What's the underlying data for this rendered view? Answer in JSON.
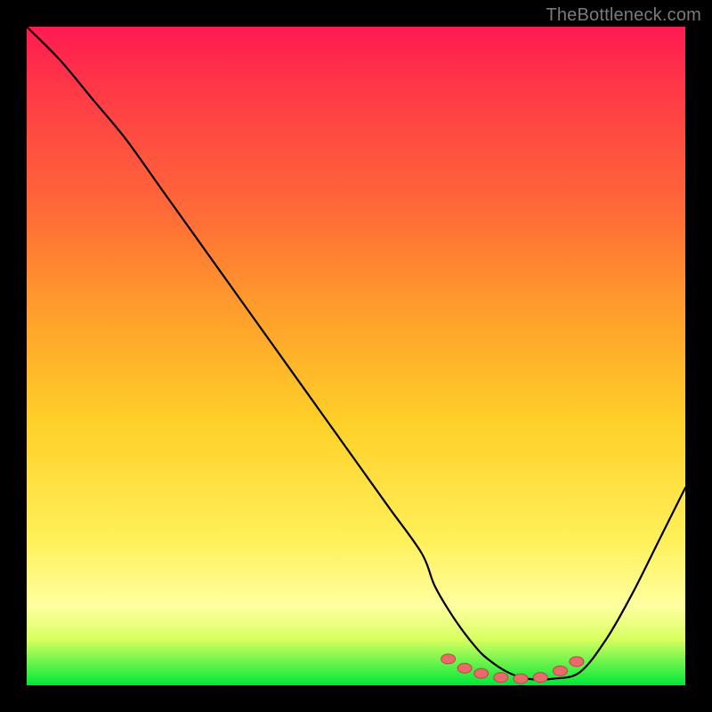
{
  "watermark": "TheBottleneck.com",
  "colors": {
    "background": "#000000",
    "curve": "#000000",
    "marker_fill": "#e96a6a",
    "marker_stroke": "#b94848",
    "gradient_top": "#ff1a52",
    "gradient_bottom": "#00e838"
  },
  "chart_data": {
    "type": "line",
    "title": "",
    "xlabel": "",
    "ylabel": "",
    "xlim": [
      0,
      100
    ],
    "ylim": [
      0,
      100
    ],
    "grid": false,
    "legend": false,
    "series": [
      {
        "name": "bottleneck-curve",
        "x": [
          0,
          5,
          10,
          15,
          20,
          25,
          30,
          35,
          40,
          45,
          50,
          55,
          60,
          62,
          65,
          68,
          70,
          73,
          76,
          80,
          84,
          88,
          92,
          96,
          100
        ],
        "y": [
          100,
          95,
          89,
          83,
          76,
          69,
          62,
          55,
          48,
          41,
          34,
          27,
          20,
          15,
          10,
          6,
          4,
          2,
          1,
          1,
          2,
          7,
          14,
          22,
          30
        ]
      }
    ],
    "markers": {
      "name": "optimal-range-dots",
      "x": [
        64,
        66.5,
        69,
        72,
        75,
        78,
        81,
        83.5
      ],
      "y": [
        4.0,
        2.6,
        1.8,
        1.2,
        1.0,
        1.2,
        2.2,
        3.6
      ]
    }
  }
}
